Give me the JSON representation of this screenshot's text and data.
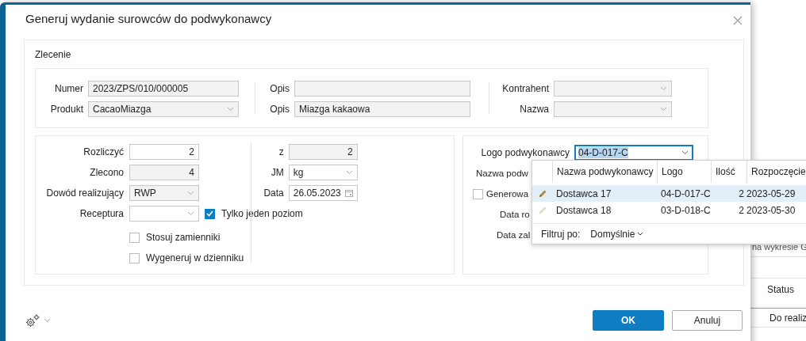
{
  "dialog": {
    "title": "Generuj wydanie surowców do podwykonawcy"
  },
  "order": {
    "title": "Zlecenie",
    "columns": [
      [
        {
          "label": "Numer",
          "value": "2023/ZPS/010/000005",
          "kind": "text",
          "disabled": true
        },
        {
          "label": "Produkt",
          "value": "CacaoMiazga",
          "kind": "combo",
          "disabled": true
        }
      ],
      [
        {
          "label": "Opis",
          "kind": "text",
          "disabled": true
        },
        {
          "label": "Opis",
          "value": "Miazga kakaowa",
          "kind": "text",
          "disabled": true
        }
      ],
      [
        {
          "label": "Kontrahent",
          "kind": "combo",
          "disabled": true
        },
        {
          "label": "Nazwa",
          "kind": "combo",
          "disabled": true
        }
      ]
    ]
  },
  "quantities": {
    "rows": [
      {
        "label": "Rozliczyć",
        "value": "2",
        "kind": "number",
        "disabled": false
      },
      {
        "label": "Zlecono",
        "value": "4",
        "kind": "number",
        "disabled": true
      },
      {
        "label": "Dowód realizujący",
        "value": "RWP",
        "kind": "combo",
        "disabled": true
      },
      {
        "label": "Receptura",
        "kind": "combo",
        "disabled": false,
        "checkbox": {
          "label": "Tylko jeden poziom",
          "checked": true
        }
      }
    ],
    "checkboxes": [
      {
        "label": "Stosuj zamienniki",
        "checked": false
      },
      {
        "label": "Wygeneruj w dzienniku",
        "checked": false
      }
    ],
    "side": [
      {
        "label": "z",
        "value": "2",
        "kind": "number",
        "disabled": true
      },
      {
        "label": "JM",
        "value": "kg",
        "kind": "combo",
        "disabled": false
      },
      {
        "label": "Data",
        "value": "26.05.2023",
        "kind": "date",
        "disabled": false
      }
    ]
  },
  "subcontractor": {
    "logo_field": {
      "label": "Logo podwykonawcy",
      "value": "04-D-017-C",
      "focused": true
    },
    "rows": [
      {
        "kind": "label",
        "label": "Nazwa podw"
      },
      {
        "kind": "checkbox",
        "label": "Generowa",
        "checked": false
      },
      {
        "kind": "label",
        "label": "Data ro"
      },
      {
        "kind": "label",
        "label": "Data zal"
      }
    ]
  },
  "dropdown": {
    "columns": [
      "Nazwa podwykonawcy",
      "Logo",
      "Ilość",
      "Rozpoczęcie"
    ],
    "rows": [
      {
        "selected": true,
        "dimmed": false,
        "cells": [
          "Dostawca 17",
          "04-D-017-C",
          "2",
          "2023-05-29"
        ]
      },
      {
        "selected": false,
        "dimmed": true,
        "cells": [
          "Dostawca 18",
          "03-D-018-C",
          "2",
          "2023-05-30"
        ]
      }
    ],
    "filter_label": "Filtruj po:",
    "filter_value": "Domyślnie"
  },
  "buttons": [
    {
      "label": "OK",
      "kind": "primary"
    },
    {
      "label": "Anuluj",
      "kind": "secondary"
    }
  ],
  "background": {
    "caption": "na wykresie G",
    "column_header": "Status",
    "cell": "Do realiz"
  }
}
